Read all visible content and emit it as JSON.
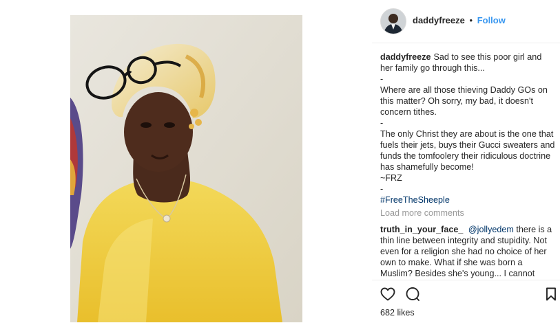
{
  "post": {
    "username": "daddyfreeze",
    "separator": "•",
    "follow_label": "Follow",
    "caption": {
      "username": "daddyfreeze",
      "lines": [
        "Sad to see this poor girl and her family go through this...",
        "-",
        "Where are all those thieving Daddy GOs on this matter? Oh sorry, my bad, it doesn't concern tithes.",
        "-",
        "The only Christ they are about is the one that fuels their jets, buys their Gucci sweaters and funds the tomfoolery their ridiculous doctrine has shamefully become!",
        "~FRZ",
        "-"
      ],
      "hashtag": "#FreeTheSheeple"
    },
    "load_more_label": "Load more comments",
    "comment": {
      "username": "truth_in_your_face_",
      "mention": "@jollyedem",
      "text": "there is a thin line between integrity and stupidity. Not even for a religion she had no choice of her own to make. What if she was born a Muslim? Besides she's young... I cannot"
    },
    "likes_label": "682 likes"
  },
  "icons": {
    "like": "heart-icon",
    "comment": "comment-icon",
    "save": "bookmark-icon"
  },
  "colors": {
    "follow": "#3897f0",
    "hashtag": "#003569",
    "muted": "#999999",
    "text": "#262626"
  }
}
